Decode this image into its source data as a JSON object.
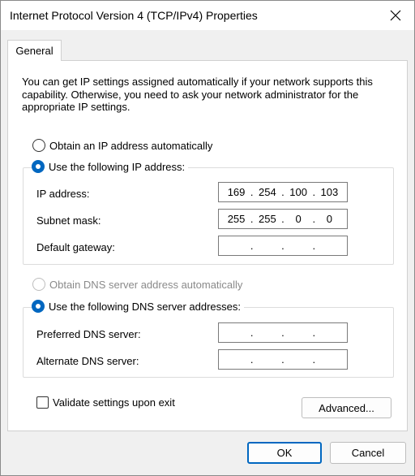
{
  "window": {
    "title": "Internet Protocol Version 4 (TCP/IPv4) Properties",
    "close_icon": "close-icon"
  },
  "tabs": [
    {
      "label": "General",
      "selected": true
    }
  ],
  "description": "You can get IP settings assigned automatically if your network supports this capability. Otherwise, you need to ask your network administrator for the appropriate IP settings.",
  "ip_mode": {
    "auto_label": "Obtain an IP address automatically",
    "auto_selected": false,
    "manual_label": "Use the following IP address:",
    "manual_selected": true
  },
  "ip_fields": {
    "ip_address": {
      "label": "IP address:",
      "octets": [
        "169",
        "254",
        "100",
        "103"
      ]
    },
    "subnet_mask": {
      "label": "Subnet mask:",
      "octets": [
        "255",
        "255",
        "0",
        "0"
      ]
    },
    "default_gateway": {
      "label": "Default gateway:",
      "octets": [
        "",
        "",
        "",
        ""
      ]
    }
  },
  "dns_mode": {
    "auto_label": "Obtain DNS server address automatically",
    "auto_selected": false,
    "auto_disabled": true,
    "manual_label": "Use the following DNS server addresses:",
    "manual_selected": true
  },
  "dns_fields": {
    "preferred": {
      "label": "Preferred DNS server:",
      "octets": [
        "",
        "",
        "",
        ""
      ]
    },
    "alternate": {
      "label": "Alternate DNS server:",
      "octets": [
        "",
        "",
        "",
        ""
      ]
    }
  },
  "validate": {
    "label": "Validate settings upon exit",
    "checked": false
  },
  "buttons": {
    "advanced": "Advanced...",
    "ok": "OK",
    "cancel": "Cancel"
  },
  "colors": {
    "accent": "#0067c0",
    "disabled_text": "#8a8a8a",
    "background": "#f0f0f0"
  }
}
